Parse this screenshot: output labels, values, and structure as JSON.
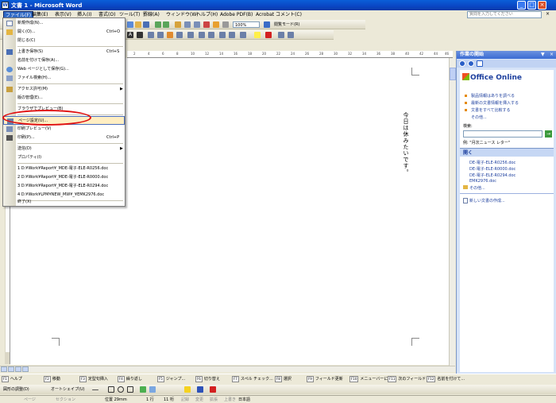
{
  "window": {
    "title": "文書 1 - Microsoft Word",
    "app_icon": "W",
    "minimize": "_",
    "maximize": "□",
    "close": "×"
  },
  "menubar": {
    "items": [
      "ファイル(F)",
      "編集(E)",
      "表示(V)",
      "挿入(I)",
      "書式(O)",
      "ツール(T)",
      "罫線(A)",
      "ウィンドウ(W)",
      "ヘルプ(H)",
      "Adobe PDF(B)",
      "Acrobat コメント(C)"
    ],
    "help_placeholder": "質問を入力してください",
    "close_doc": "×"
  },
  "toolbar": {
    "zoom": "100%",
    "reading_mode": "閲覧モード(R)"
  },
  "file_menu": {
    "items": [
      {
        "label": "新規作成(N)...",
        "shortcut": "",
        "submenu": false
      },
      {
        "label": "開く(O)...",
        "shortcut": "Ctrl+O",
        "submenu": false
      },
      {
        "label": "閉じる(C)",
        "shortcut": "",
        "submenu": false
      },
      {
        "label": "上書き保存(S)",
        "shortcut": "Ctrl+S",
        "submenu": false
      },
      {
        "label": "名前を付けて保存(A)...",
        "shortcut": "",
        "submenu": false
      },
      {
        "label": "Web ページとして保存(G)...",
        "shortcut": "",
        "submenu": false
      },
      {
        "label": "ファイル検索(H)...",
        "shortcut": "",
        "submenu": false
      },
      {
        "label": "アクセス許可(M)",
        "shortcut": "",
        "submenu": true
      },
      {
        "label": "版の管理(E)...",
        "shortcut": "",
        "submenu": false
      },
      {
        "label": "ブラウザでプレビュー(B)",
        "shortcut": "",
        "submenu": false
      },
      {
        "label": "ページ設定(U)...",
        "shortcut": "",
        "submenu": false
      },
      {
        "label": "印刷プレビュー(V)",
        "shortcut": "",
        "submenu": false
      },
      {
        "label": "印刷(P)...",
        "shortcut": "Ctrl+P",
        "submenu": false
      },
      {
        "label": "送信(D)",
        "shortcut": "",
        "submenu": true
      },
      {
        "label": "プロパティ(I)",
        "shortcut": "",
        "submenu": false
      },
      {
        "label": "1 D:¥Work¥Report¥_MDE-電子-ELE-R0256.doc",
        "shortcut": "",
        "submenu": false
      },
      {
        "label": "2 D:¥Work¥Report¥_MDE-電子-ELE-R0000.doc",
        "shortcut": "",
        "submenu": false
      },
      {
        "label": "3 D:¥Work¥Report¥_MDE-電子-ELE-R0294.doc",
        "shortcut": "",
        "submenu": false
      },
      {
        "label": "4 D:¥Work¥LPM¥NEW_MW¥_¥EMK2976.doc",
        "shortcut": "",
        "submenu": false
      },
      {
        "label": "終了(X)",
        "shortcut": "",
        "submenu": false
      }
    ],
    "highlighted": "ページ設定(U)..."
  },
  "document": {
    "text": "今日は休みたいです。"
  },
  "ruler_ticks": [
    "2",
    "4",
    "6",
    "8",
    "10",
    "12",
    "14",
    "16",
    "18",
    "20",
    "22",
    "24",
    "26",
    "28",
    "30",
    "32",
    "34",
    "36",
    "38",
    "40",
    "42",
    "44",
    "46"
  ],
  "task_pane": {
    "title": "作業の開始",
    "close": "×",
    "dropdown": "▼",
    "brand": "Office Online",
    "links": [
      "製品情報はありを調べる",
      "最新の文書情報を挿入する",
      "文書をすべて比較する",
      "その他..."
    ],
    "search_label": "検索:",
    "search_example": "例: \"月次ニュース レター\"",
    "search_go": "→",
    "open_section": "開く",
    "recent_files": [
      "DE-電子-ELE-R0256.doc",
      "DE-電子-ELE-R0000.doc",
      "DE-電子-ELE-R0294.doc",
      "EMK2976.doc",
      "その他..."
    ],
    "new_doc": "新しい文書の作成..."
  },
  "fkeys": [
    {
      "num": "F1",
      "label": "ヘルプ"
    },
    {
      "num": "F2",
      "label": "移動"
    },
    {
      "num": "F3",
      "label": "定型句挿入"
    },
    {
      "num": "F4",
      "label": "繰り返し"
    },
    {
      "num": "F5",
      "label": "ジャンプ..."
    },
    {
      "num": "F6",
      "label": "切り替え"
    },
    {
      "num": "F7",
      "label": "スペル チェック..."
    },
    {
      "num": "F8",
      "label": "選択"
    },
    {
      "num": "F9",
      "label": "フィールド更新"
    },
    {
      "num": "F10",
      "label": "メニューバーに"
    },
    {
      "num": "F11",
      "label": "次のフィールド"
    },
    {
      "num": "F12",
      "label": "名前を付けて..."
    }
  ],
  "drawbar": {
    "draw_menu": "図形の調整(D)",
    "autoshapes": "オートシェイプ(U)"
  },
  "status": {
    "page": "ページ",
    "section": "セクション",
    "position": "位置  29mm",
    "line": "1 行",
    "column": "11 桁",
    "rec": "記録",
    "trk": "変更",
    "ext": "拡張",
    "ovr": "上書き",
    "lang": "日本語"
  }
}
